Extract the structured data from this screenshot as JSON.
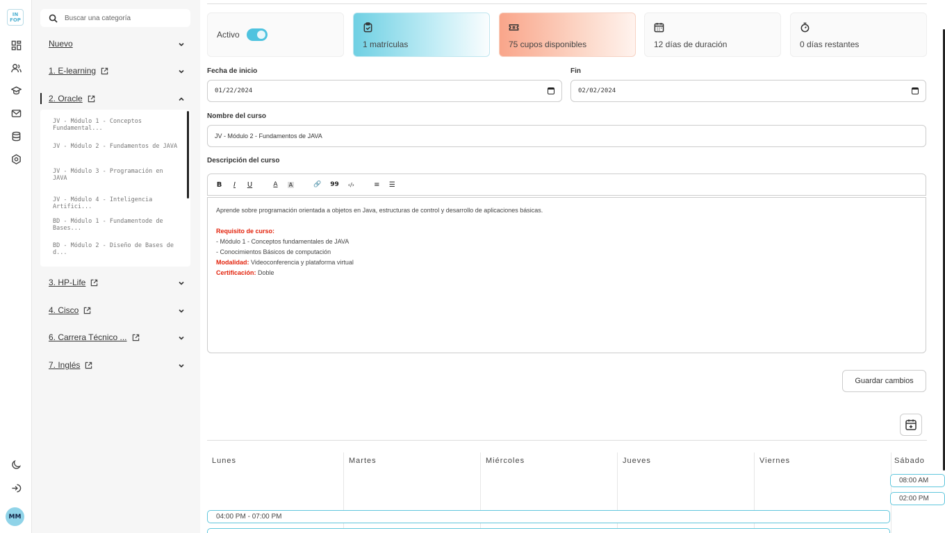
{
  "brand": {
    "logo_text": "IN\nFOP"
  },
  "rail": {
    "icons": [
      "dashboard-icon",
      "users-icon",
      "graduation-cap-icon",
      "mail-icon",
      "database-icon",
      "settings-icon"
    ],
    "bottom_icons": [
      "moon-icon",
      "logout-icon"
    ],
    "avatar_initials": "MM"
  },
  "search": {
    "placeholder": "Buscar una categoría"
  },
  "categories": [
    {
      "label": "Nuevo",
      "external": false,
      "expanded": false
    },
    {
      "label": "1. E-learning",
      "external": true,
      "expanded": false
    },
    {
      "label": "2. Oracle",
      "external": true,
      "expanded": true
    },
    {
      "label": "3. HP-Life",
      "external": true,
      "expanded": false
    },
    {
      "label": "4. Cisco",
      "external": true,
      "expanded": false
    },
    {
      "label": "6. Carrera Técnico ...",
      "external": true,
      "expanded": false
    },
    {
      "label": "7. Inglés",
      "external": true,
      "expanded": false
    }
  ],
  "oracle_courses": [
    "JV - Módulo 1 - Conceptos Fundamental...",
    "JV - Módulo 2 - Fundamentos de JAVA",
    "JV - Módulo 3 - Programación en JAVA",
    "JV - Módulo 4 - Inteligencia Artifici...",
    "BD - Módulo 1 - Fundamentode de Bases...",
    "BD - Módulo 2 - Diseño de Bases de d..."
  ],
  "stats": {
    "active_label": "Activo",
    "active": true,
    "enrollments": "1 matrículas",
    "seats": "75 cupos disponibles",
    "duration": "12 días de duración",
    "remaining": "0 días restantes"
  },
  "form": {
    "start_label": "Fecha de inicio",
    "start_value": "01/22/2024",
    "end_label": "Fin",
    "end_value": "02/02/2024",
    "name_label": "Nombre del curso",
    "name_value": "JV - Módulo 2 - Fundamentos de JAVA",
    "desc_label": "Descripción del curso"
  },
  "toolbar": {
    "bold": "B",
    "italic": "I",
    "underline": "U",
    "text_color": "A",
    "bg_color": "A",
    "link": "🔗",
    "quote": "99",
    "code": "‹/›",
    "ordered_list": "≡",
    "bullet_list": "☰"
  },
  "description": {
    "intro": "Aprende sobre programación orientada a objetos en Java, estructuras de control y desarrollo de aplicaciones básicas.",
    "req_label": "Requisito de curso:",
    "req_1": "- Módulo 1 - Conceptos fundamentales de JAVA",
    "req_2": "- Conocimientos Básicos de computación",
    "mode_label": "Modalidad:",
    "mode_value": "Videoconferencia y plataforma virtual",
    "cert_label": "Certificación:",
    "cert_value": "Doble"
  },
  "actions": {
    "save": "Guardar cambios"
  },
  "schedule": {
    "days": [
      "Lunes",
      "Martes",
      "Miércoles",
      "Jueves",
      "Viernes",
      "Sábado"
    ],
    "saturday_slots": [
      "08:00 AM",
      "02:00 PM"
    ],
    "weekday_slot": "04:00 PM - 07:00 PM"
  },
  "colors": {
    "accent": "#4fc3df",
    "enrollment_card": "#6fd0e3",
    "seats_card": "#f9a58a",
    "required_text": "#e3220b"
  }
}
